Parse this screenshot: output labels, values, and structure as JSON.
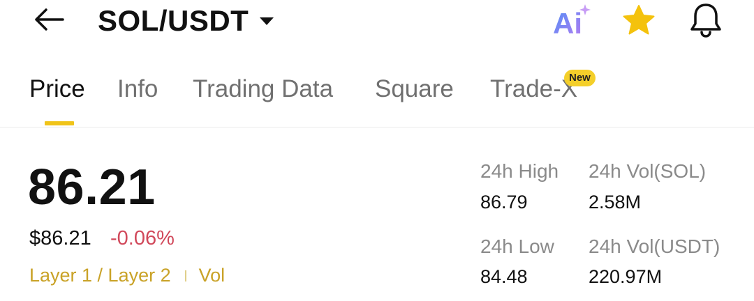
{
  "header": {
    "pair": "SOL/USDT",
    "icons": {
      "back": "arrow-left-icon",
      "pair_dropdown": "caret-down-icon",
      "ai": "ai-icon",
      "favorite": "star-icon",
      "alerts": "bell-icon"
    },
    "ai_label": "Ai",
    "colors": {
      "star": "#f4c20d",
      "ai_gradient_start": "#5a8cf2",
      "ai_gradient_end": "#b07cf0"
    }
  },
  "tabs": [
    {
      "label": "Price",
      "active": true
    },
    {
      "label": "Info",
      "active": false
    },
    {
      "label": "Trading Data",
      "active": false
    },
    {
      "label": "Square",
      "active": false
    },
    {
      "label": "Trade-X",
      "active": false,
      "badge": "New"
    }
  ],
  "price": {
    "last": "86.21",
    "usd": "$86.21",
    "change": "-0.06%",
    "change_color": "#d1495b"
  },
  "tags": [
    "Layer 1 / Layer 2",
    "Vol"
  ],
  "stats": {
    "high_label": "24h High",
    "high_value": "86.79",
    "low_label": "24h Low",
    "low_value": "84.48",
    "vol_base_label": "24h Vol(SOL)",
    "vol_base_value": "2.58M",
    "vol_quote_label": "24h Vol(USDT)",
    "vol_quote_value": "220.97M"
  },
  "accent_color": "#f0c419"
}
